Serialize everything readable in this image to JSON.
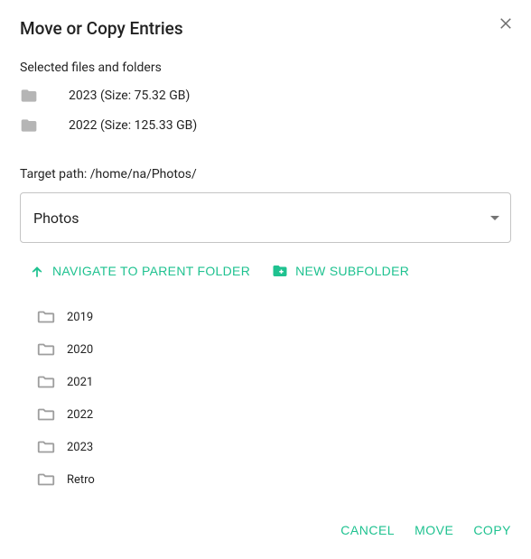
{
  "dialog": {
    "title": "Move or Copy Entries",
    "selected_label": "Selected files and folders",
    "selected_items": [
      {
        "name": "2023",
        "size": "75.32 GB",
        "display": "2023 (Size: 75.32 GB)"
      },
      {
        "name": "2022",
        "size": "125.33 GB",
        "display": "2022 (Size: 125.33 GB)"
      }
    ],
    "target_path_label": "Target path: ",
    "target_path_value": "/home/na/Photos/",
    "target_path_display": "Target path: /home/na/Photos/",
    "select_value": "Photos",
    "navigate_parent_label": "NAVIGATE TO PARENT FOLDER",
    "new_subfolder_label": "NEW SUBFOLDER",
    "folders": [
      {
        "name": "2019"
      },
      {
        "name": "2020"
      },
      {
        "name": "2021"
      },
      {
        "name": "2022"
      },
      {
        "name": "2023"
      },
      {
        "name": "Retro"
      }
    ],
    "buttons": {
      "cancel": "CANCEL",
      "move": "MOVE",
      "copy": "COPY"
    }
  },
  "colors": {
    "accent": "#1fc290"
  }
}
